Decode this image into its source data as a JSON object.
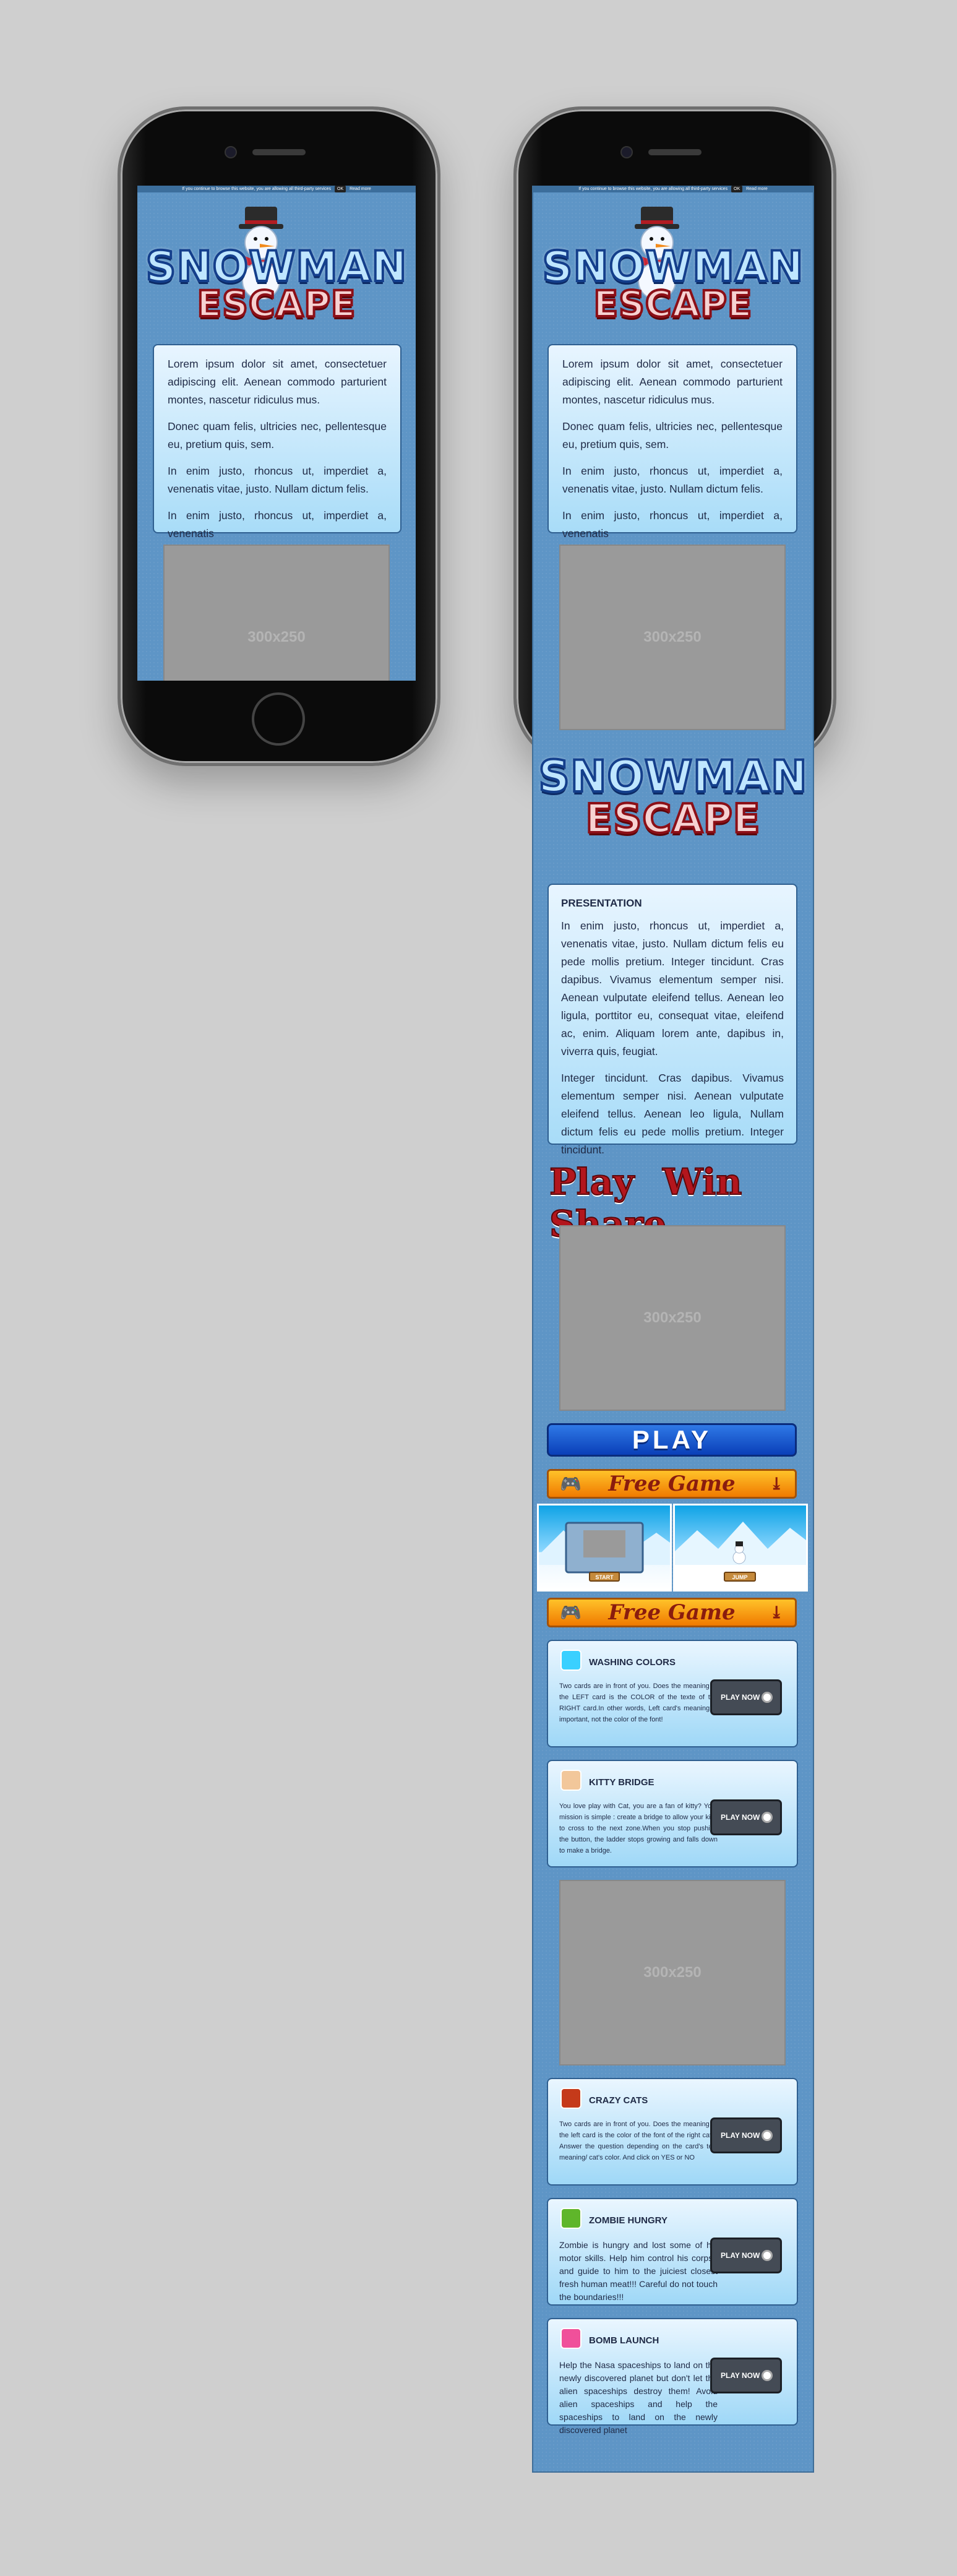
{
  "topbar": {
    "notice": "If you continue to browse this website, you are allowing all third-party services",
    "ok": "OK",
    "more": "Read more"
  },
  "logo": {
    "line1": "SNOWMAN",
    "line2": "ESCAPE"
  },
  "intro": {
    "p1": "Lorem ipsum dolor sit amet, consectetuer adipiscing elit. Aenean commodo parturient montes, nascetur ridiculus mus.",
    "p2": "Donec quam felis, ultricies nec, pellentesque eu, pretium quis, sem.",
    "p3": "In enim justo, rhoncus ut, imperdiet a, venenatis vitae, justo. Nullam dictum felis.",
    "p4": "In enim justo, rhoncus ut, imperdiet a, venenatis"
  },
  "ad": {
    "label": "300x250"
  },
  "presentation": {
    "title": "PRESENTATION",
    "p1": "In enim justo, rhoncus ut, imperdiet a, venenatis vitae, justo. Nullam dictum felis eu pede mollis pretium. Integer tincidunt. Cras dapibus. Vivamus elementum semper nisi. Aenean vulputate eleifend tellus. Aenean leo ligula, porttitor eu, consequat vitae, eleifend ac, enim. Aliquam lorem ante, dapibus in, viverra quis, feugiat.",
    "p2": "Integer tincidunt. Cras dapibus. Vivamus elementum semper nisi. Aenean vulputate eleifend tellus. Aenean leo ligula, Nullam dictum felis eu pede mollis pretium. Integer tincidunt."
  },
  "play_win_share": "Play Win Share",
  "play_button": "PLAY",
  "free_game": "Free Game",
  "screenshots": {
    "start": "START",
    "jump": "JUMP"
  },
  "play_now": "PLAY NOW",
  "games": [
    {
      "title": "WASHING COLORS",
      "desc": "Two cards are in front of you. Does the meaning of the LEFT card is the COLOR of the texte of the RIGHT card.In other words, Left card's meaning is important, not the color of the font!",
      "icon": "#3ad0ff"
    },
    {
      "title": "KITTY BRIDGE",
      "desc": "You love play with Cat, you are a fan of kitty? Your mission is simple : create a bridge to allow your kitty to cross to the next zone.When you stop pushing the button, the ladder stops growing and falls down to make a bridge.",
      "icon": "#f2c79a"
    },
    {
      "title": "CRAZY CATS",
      "desc": "Two cards are in front of you. Does the meaning of the left card is the color of the font of the right cat ? Answer the question depending on the card's text meaning/ cat's color. And click on YES or NO",
      "icon": "#c53a1a"
    },
    {
      "title": "ZOMBIE HUNGRY",
      "desc": "Zombie is hungry and lost some of his motor skills. Help him control his corpse and guide to him to the juiciest closest fresh human meat!!! Careful do not touch the boundaries!!!",
      "icon": "#5fb62a"
    },
    {
      "title": "BOMB LAUNCH",
      "desc": "Help the Nasa spaceships to land on the newly discovered planet but don't let the alien spaceships destroy them! Avoid alien spaceships and help the spaceships to land on the newly discovered planet",
      "icon": "#f0509a"
    }
  ]
}
